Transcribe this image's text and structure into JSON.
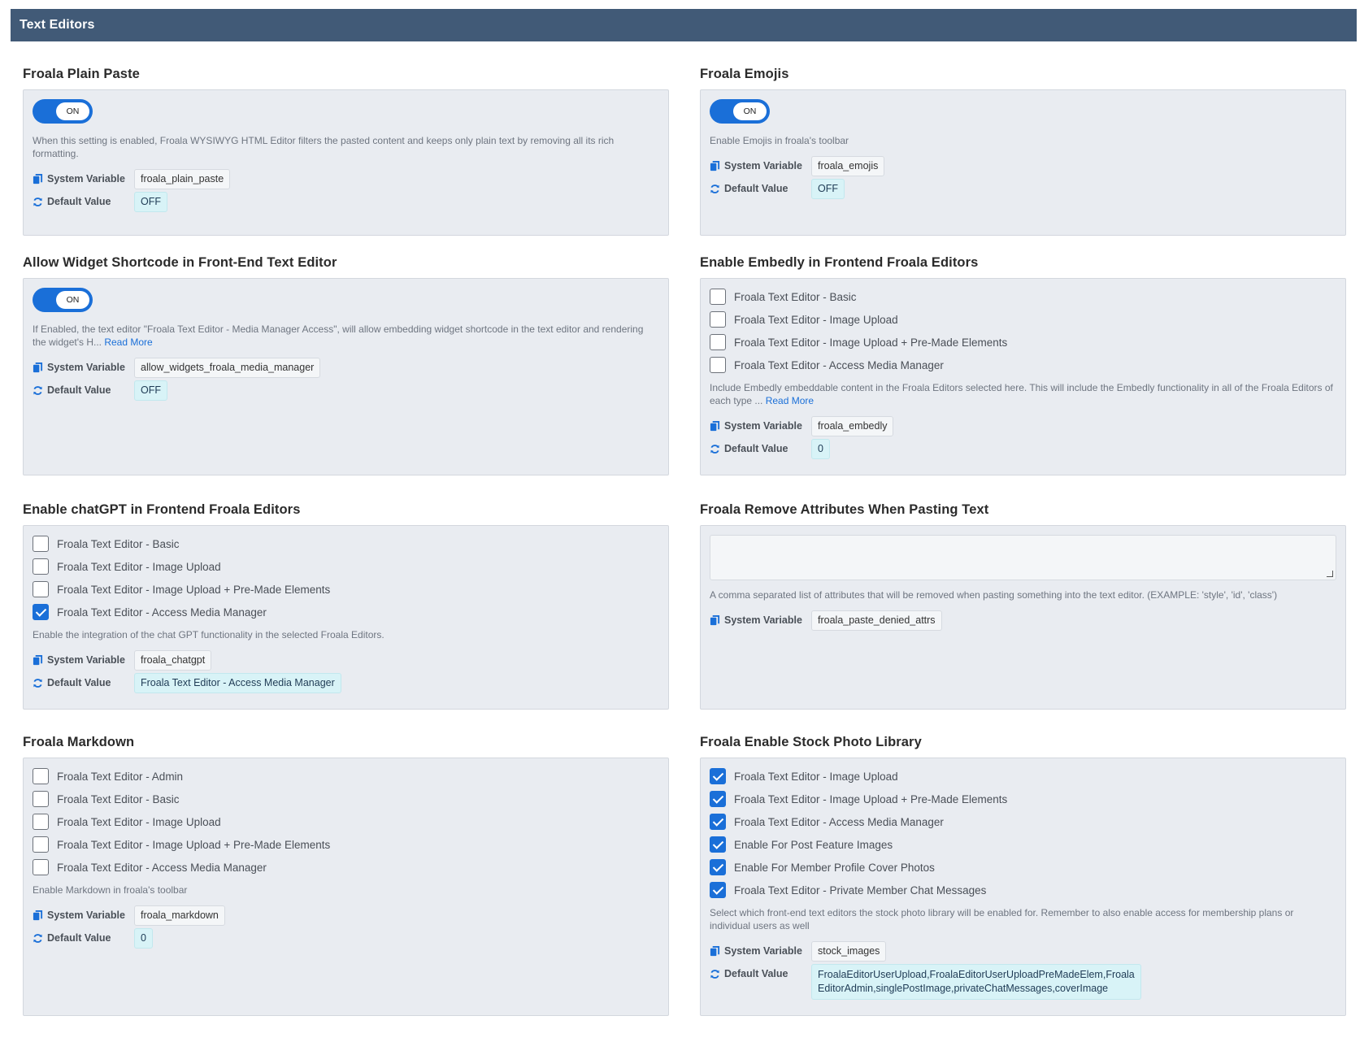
{
  "header": {
    "title": "Text Editors"
  },
  "labels": {
    "system_variable": "System Variable",
    "default_value": "Default Value"
  },
  "settings": {
    "plain_paste": {
      "title": "Froala Plain Paste",
      "toggle": "ON",
      "description": "When this setting is enabled, Froala WYSIWYG HTML Editor filters the pasted content and keeps only plain text by removing all its rich formatting.",
      "system_variable": "froala_plain_paste",
      "default_value": "OFF"
    },
    "emojis": {
      "title": "Froala Emojis",
      "toggle": "ON",
      "description": "Enable Emojis in froala's toolbar",
      "system_variable": "froala_emojis",
      "default_value": "OFF"
    },
    "widget_shortcode": {
      "title": "Allow Widget Shortcode in Front-End Text Editor",
      "toggle": "ON",
      "description": "If Enabled, the text editor \"Froala Text Editor - Media Manager Access\", will allow embedding widget shortcode in the text editor and rendering the widget's H...",
      "read_more": "Read More",
      "system_variable": "allow_widgets_froala_media_manager",
      "default_value": "OFF"
    },
    "embedly": {
      "title": "Enable Embedly in Frontend Froala Editors",
      "options": [
        {
          "label": "Froala Text Editor - Basic",
          "checked": false
        },
        {
          "label": "Froala Text Editor - Image Upload",
          "checked": false
        },
        {
          "label": "Froala Text Editor - Image Upload + Pre-Made Elements",
          "checked": false
        },
        {
          "label": "Froala Text Editor - Access Media Manager",
          "checked": false
        }
      ],
      "description": "Include Embedly embeddable content in the Froala Editors selected here.  This will include the Embedly functionality in all of the Froala Editors of each type ...",
      "read_more": "Read More",
      "system_variable": "froala_embedly",
      "default_value": "0"
    },
    "chatgpt": {
      "title": "Enable chatGPT in Frontend Froala Editors",
      "options": [
        {
          "label": "Froala Text Editor - Basic",
          "checked": false
        },
        {
          "label": "Froala Text Editor - Image Upload",
          "checked": false
        },
        {
          "label": "Froala Text Editor - Image Upload + Pre-Made Elements",
          "checked": false
        },
        {
          "label": "Froala Text Editor - Access Media Manager",
          "checked": true
        }
      ],
      "description": "Enable the integration of the chat GPT functionality in the selected Froala Editors.",
      "system_variable": "froala_chatgpt",
      "default_value": "Froala Text Editor - Access Media Manager"
    },
    "remove_attrs": {
      "title": "Froala Remove Attributes When Pasting Text",
      "textarea_value": "",
      "description": "A comma separated list of attributes that will be removed when pasting something into the text editor. (EXAMPLE: 'style', 'id', 'class')",
      "system_variable": "froala_paste_denied_attrs"
    },
    "markdown": {
      "title": "Froala Markdown",
      "options": [
        {
          "label": "Froala Text Editor - Admin",
          "checked": false
        },
        {
          "label": "Froala Text Editor - Basic",
          "checked": false
        },
        {
          "label": "Froala Text Editor - Image Upload",
          "checked": false
        },
        {
          "label": "Froala Text Editor - Image Upload + Pre-Made Elements",
          "checked": false
        },
        {
          "label": "Froala Text Editor - Access Media Manager",
          "checked": false
        }
      ],
      "description": "Enable Markdown in froala's toolbar",
      "system_variable": "froala_markdown",
      "default_value": "0"
    },
    "stock_photo": {
      "title": "Froala Enable Stock Photo Library",
      "options": [
        {
          "label": "Froala Text Editor - Image Upload",
          "checked": true
        },
        {
          "label": "Froala Text Editor - Image Upload + Pre-Made Elements",
          "checked": true
        },
        {
          "label": "Froala Text Editor - Access Media Manager",
          "checked": true
        },
        {
          "label": "Enable For Post Feature Images",
          "checked": true
        },
        {
          "label": "Enable For Member Profile Cover Photos",
          "checked": true
        },
        {
          "label": "Froala Text Editor - Private Member Chat Messages",
          "checked": true
        }
      ],
      "description": "Select which front-end text editors the stock photo library will be enabled for. Remember to also enable access for membership plans or individual users as well",
      "system_variable": "stock_images",
      "default_value_line1": "FroalaEditorUserUpload,FroalaEditorUserUploadPreMadeElem,Froala",
      "default_value_line2": "EditorAdmin,singlePostImage,privateChatMessages,coverImage"
    }
  },
  "colors": {
    "header_bg": "#415a77",
    "accent": "#1a6fd8",
    "panel_bg": "#e9ecf1",
    "default_chip_bg": "#d8f3f7"
  },
  "icons": {
    "system_variable": "copy-icon",
    "default_value": "refresh-icon"
  }
}
